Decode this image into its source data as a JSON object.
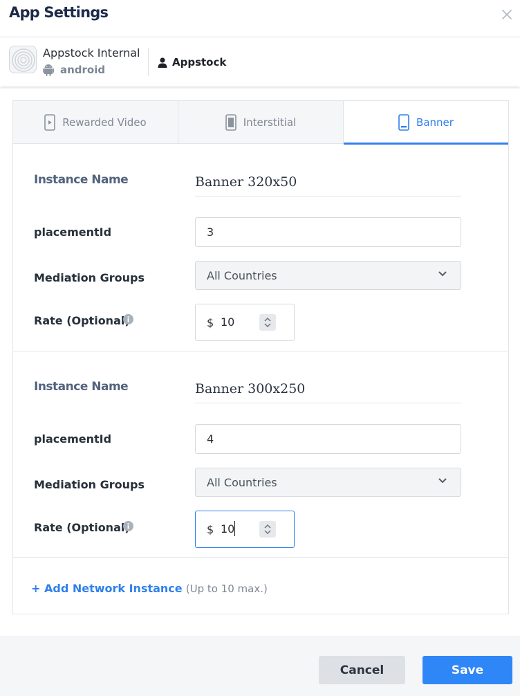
{
  "modal": {
    "title": "App Settings"
  },
  "app": {
    "name": "Appstock Internal",
    "platform": "android",
    "account": "Appstock"
  },
  "tabs": [
    {
      "label": "Rewarded Video",
      "icon": "rewarded-video-icon",
      "active": false
    },
    {
      "label": "Interstitial",
      "icon": "interstitial-icon",
      "active": false
    },
    {
      "label": "Banner",
      "icon": "banner-icon",
      "active": true
    }
  ],
  "instances": [
    {
      "instance_name_label": "Instance Name",
      "instance_name": "Banner 320x50",
      "placement_label": "placementId",
      "placement_value": "3",
      "mediation_label": "Mediation Groups",
      "mediation_value": "All Countries",
      "rate_label": "Rate (Optional)",
      "currency": "$",
      "rate_value": "10"
    },
    {
      "instance_name_label": "Instance Name",
      "instance_name": "Banner 300x250",
      "placement_label": "placementId",
      "placement_value": "4",
      "mediation_label": "Mediation Groups",
      "mediation_value": "All Countries",
      "rate_label": "Rate (Optional)",
      "currency": "$",
      "rate_value": "10"
    }
  ],
  "add_instance": {
    "link": "+ Add Network Instance",
    "hint": "(Up to 10 max.)"
  },
  "footer": {
    "cancel": "Cancel",
    "save": "Save"
  },
  "colors": {
    "accent": "#2f80ed",
    "save_button": "#2f86f6",
    "title": "#1d2b4a"
  }
}
